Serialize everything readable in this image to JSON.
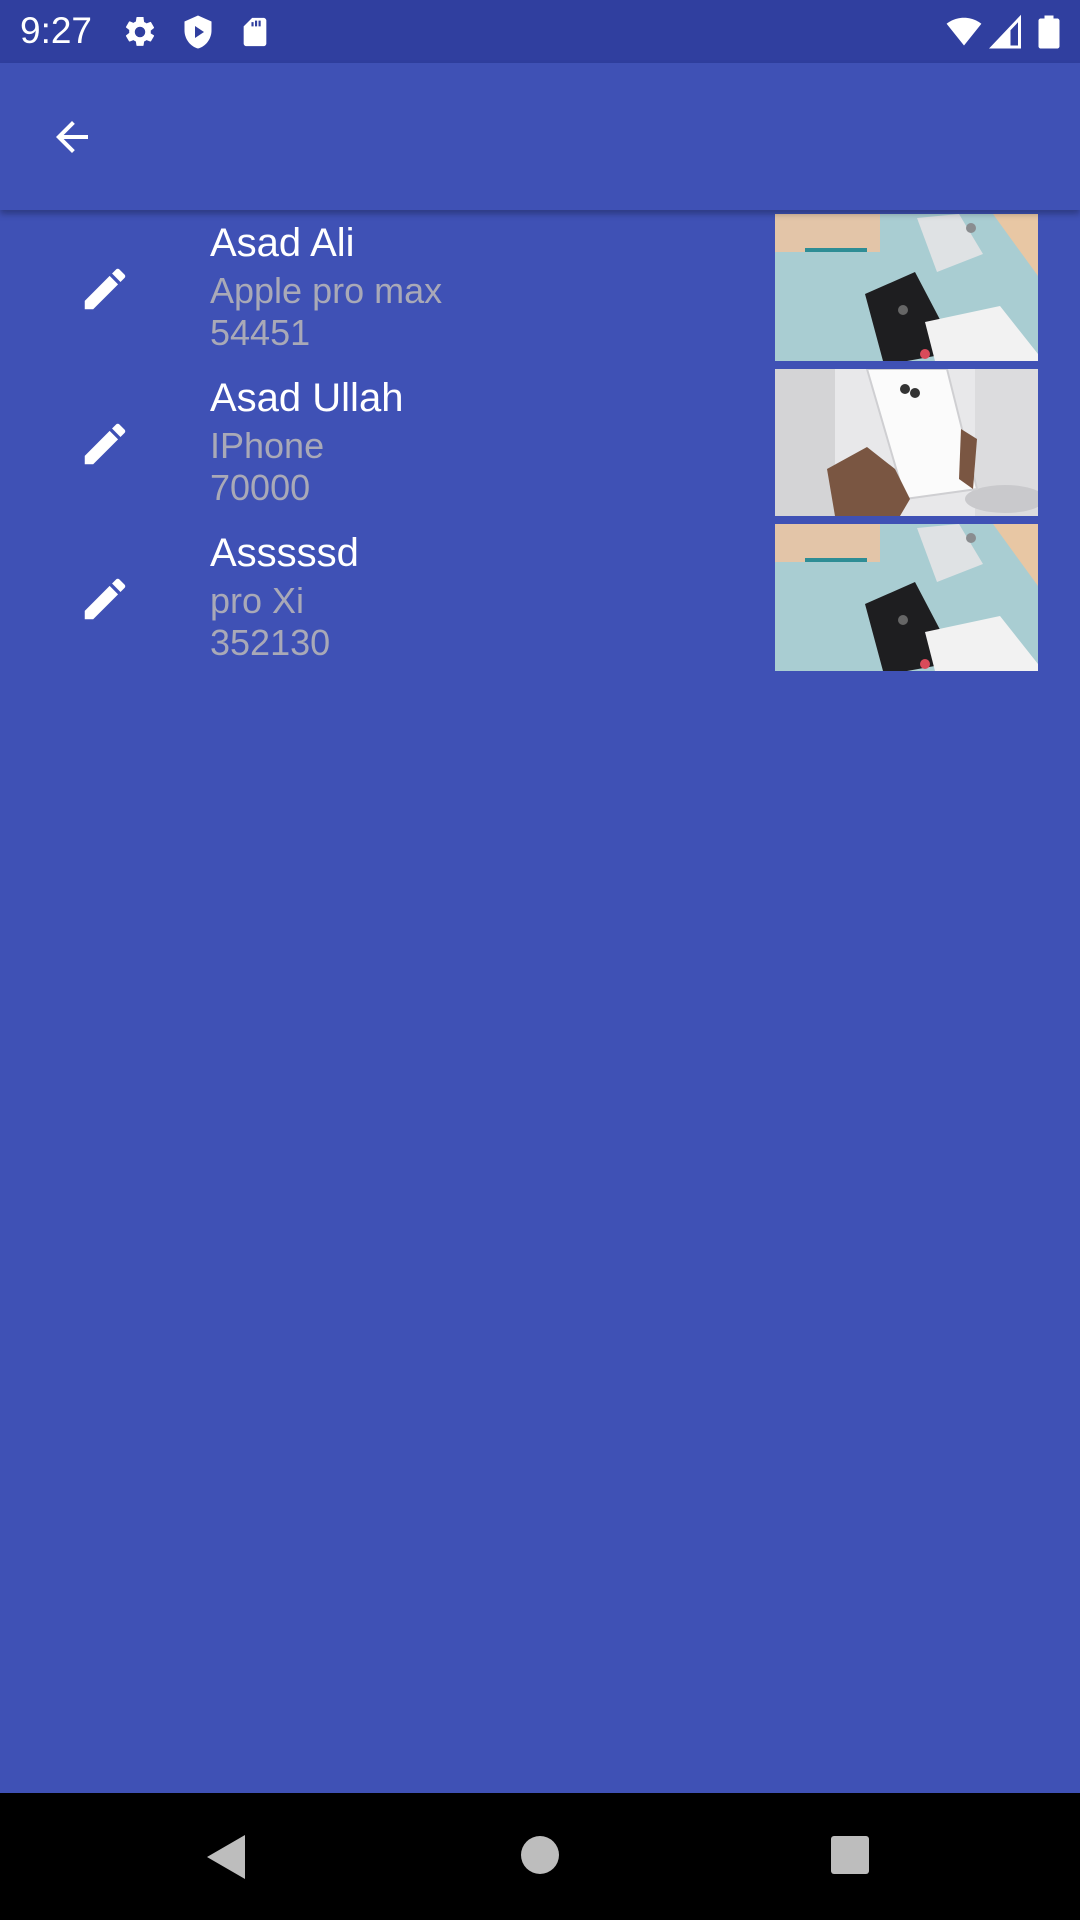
{
  "status_bar": {
    "time": "9:27",
    "left_icons": [
      "gear-icon",
      "shield-play-icon",
      "sd-card-icon"
    ],
    "right_icons": [
      "wifi-icon",
      "signal-icon",
      "battery-icon"
    ]
  },
  "app_bar": {
    "back_icon": "arrow-back-icon"
  },
  "items": [
    {
      "name": "Asad Ali",
      "model": "Apple pro max",
      "price": "54451",
      "action_icon": "edit-pencil-icon",
      "image": "phones-flatlay-photo"
    },
    {
      "name": "Asad Ullah",
      "model": "IPhone",
      "price": "70000",
      "action_icon": "edit-pencil-icon",
      "image": "hand-holding-iphone-photo"
    },
    {
      "name": "Asssssd",
      "model": "pro Xi",
      "price": "352130",
      "action_icon": "edit-pencil-icon",
      "image": "phones-flatlay-photo"
    }
  ],
  "nav_bar": {
    "buttons": [
      "back-triangle-icon",
      "home-circle-icon",
      "recents-square-icon"
    ]
  },
  "colors": {
    "background": "#3f51b5",
    "status_bar": "#303f9f",
    "primary_text": "#ffffff",
    "secondary_text": "#a9a9b7"
  }
}
